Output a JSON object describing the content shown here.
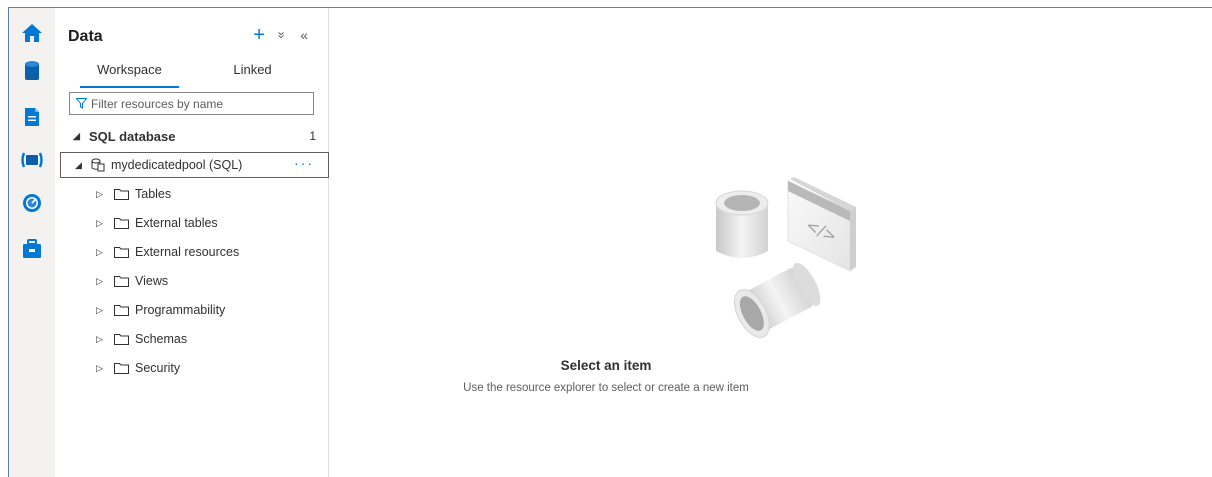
{
  "pane": {
    "title": "Data",
    "actions": {
      "add_glyph": "+",
      "collapse_all_glyph": "»",
      "hide_pane_glyph": "«"
    }
  },
  "tabs": [
    {
      "label": "Workspace",
      "active": true
    },
    {
      "label": "Linked",
      "active": false
    }
  ],
  "filter": {
    "placeholder": "Filter resources by name",
    "value": ""
  },
  "tree": {
    "section": {
      "label": "SQL database",
      "count": "1"
    },
    "pool": {
      "label": "mydedicatedpool (SQL)",
      "more_glyph": "···"
    },
    "children": [
      {
        "label": "Tables"
      },
      {
        "label": "External tables"
      },
      {
        "label": "External resources"
      },
      {
        "label": "Views"
      },
      {
        "label": "Programmability"
      },
      {
        "label": "Schemas"
      },
      {
        "label": "Security"
      }
    ]
  },
  "rail": [
    {
      "name": "home-icon",
      "color": "#0078d4"
    },
    {
      "name": "data-icon",
      "color": "#0078d4"
    },
    {
      "name": "develop-icon",
      "color": "#0078d4"
    },
    {
      "name": "integrate-icon",
      "color": "#0078d4"
    },
    {
      "name": "monitor-icon",
      "color": "#0078d4"
    },
    {
      "name": "manage-icon",
      "color": "#0078d4"
    }
  ],
  "empty_state": {
    "title": "Select an item",
    "subtitle": "Use the resource explorer to select or create a new item"
  },
  "colors": {
    "accent": "#0078d4",
    "border": "#5b7fb0"
  }
}
